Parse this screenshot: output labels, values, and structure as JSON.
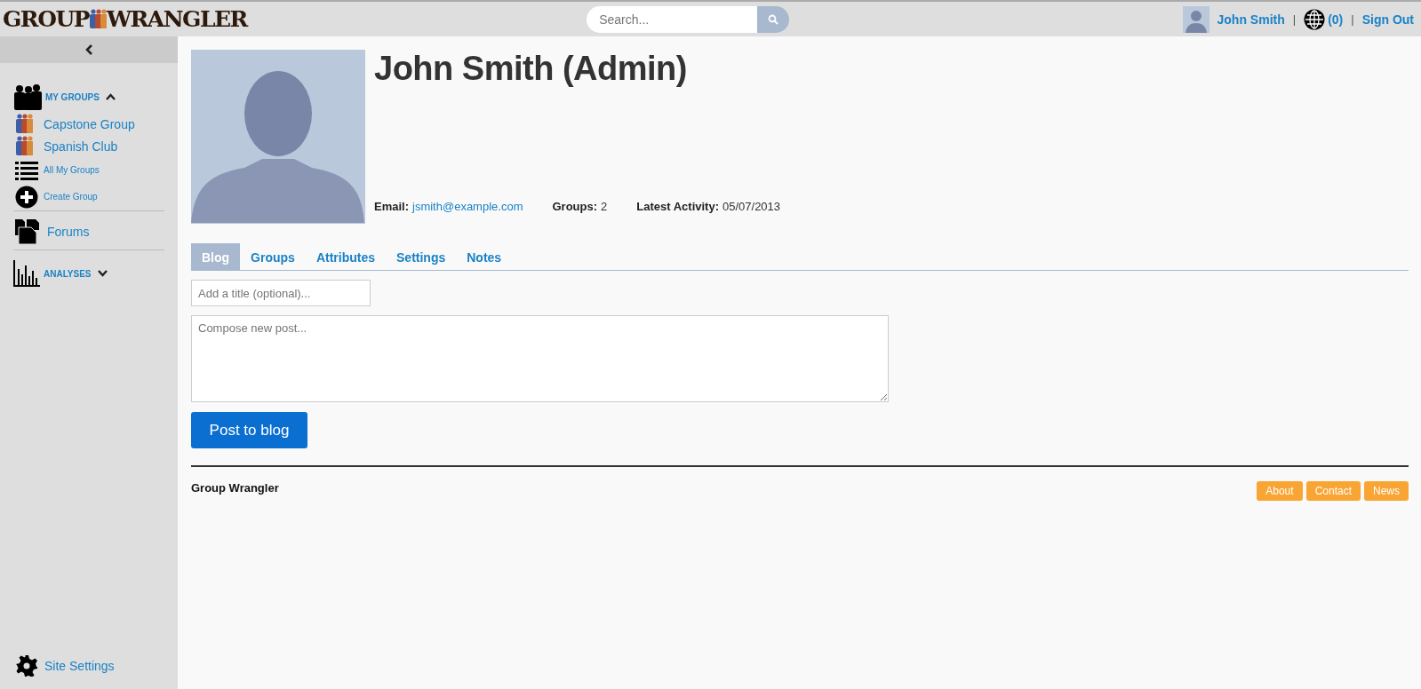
{
  "header": {
    "logo": {
      "left": "GROUP",
      "right": "WRANGLER"
    },
    "search": {
      "placeholder": "Search..."
    },
    "user": "John Smith",
    "separators": [
      "|",
      "|"
    ],
    "notifications": "(0)",
    "sign_out": "Sign Out"
  },
  "sidebar": {
    "items": [
      {
        "kind": "section",
        "label": "MY GROUPS",
        "expanded": true
      },
      {
        "kind": "group",
        "label": "Capstone Group"
      },
      {
        "kind": "group",
        "label": "Spanish Club"
      },
      {
        "kind": "small",
        "label": "All My Groups"
      },
      {
        "kind": "small",
        "label": "Create Group"
      },
      {
        "kind": "big",
        "label": "Forums"
      },
      {
        "kind": "section",
        "label": "ANALYSES",
        "expanded": false
      }
    ],
    "footer": {
      "label": "Site Settings"
    }
  },
  "profile": {
    "name": "John Smith (Admin)",
    "fields": [
      {
        "label": "Email:",
        "value": "jsmith@example.com",
        "kind": "link"
      },
      {
        "label": "Groups:",
        "value": "2",
        "kind": "text"
      },
      {
        "label": "Latest Activity:",
        "value": "05/07/2013",
        "kind": "text"
      }
    ]
  },
  "tabs": [
    {
      "label": "Blog",
      "selected": true
    },
    {
      "label": "Groups",
      "selected": false
    },
    {
      "label": "Attributes",
      "selected": false
    },
    {
      "label": "Settings",
      "selected": false
    },
    {
      "label": "Notes",
      "selected": false
    }
  ],
  "composer": {
    "title_placeholder": "Add a title (optional)...",
    "body_placeholder": "Compose new post...",
    "button": "Post to blog"
  },
  "footer": {
    "brand": "Group Wrangler",
    "links": [
      "About",
      "Contact",
      "News"
    ]
  }
}
